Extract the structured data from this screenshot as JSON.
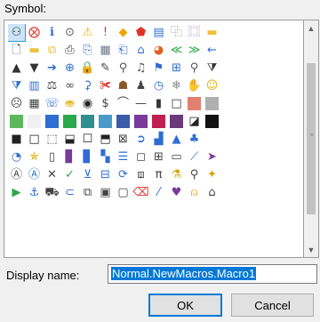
{
  "labels": {
    "symbol": "Symbol:",
    "display_name": "Display name:"
  },
  "display_name_value": "Normal.NewMacros.Macro1",
  "buttons": {
    "ok": "OK",
    "cancel": "Cancel"
  },
  "scroll": {
    "up_glyph": "▲",
    "down_glyph": "▼",
    "grip_glyph": "≡"
  },
  "selected_index": 0,
  "symbols": [
    {
      "t": "glyph",
      "g": "⚇",
      "c": "#3a3a3a",
      "n": "org-chart-icon"
    },
    {
      "t": "glyph",
      "g": "⨂",
      "c": "#e0342a",
      "n": "close-circle-icon"
    },
    {
      "t": "glyph",
      "g": "ℹ",
      "c": "#2f6dd1",
      "n": "info-icon"
    },
    {
      "t": "glyph",
      "g": "⊙",
      "c": "#555555",
      "n": "record-icon"
    },
    {
      "t": "glyph",
      "g": "⚠",
      "c": "#f2b300",
      "n": "warning-icon"
    },
    {
      "t": "glyph",
      "g": "!",
      "c": "#e0342a",
      "n": "exclamation-icon"
    },
    {
      "t": "glyph",
      "g": "◆",
      "c": "#f0a500",
      "n": "diamond-icon"
    },
    {
      "t": "glyph",
      "g": "⬟",
      "c": "#e0342a",
      "n": "shield-icon"
    },
    {
      "t": "glyph",
      "g": "▤",
      "c": "#2f6dd1",
      "n": "save-icon"
    },
    {
      "t": "glyph",
      "g": "⿻",
      "c": "#4a6b2a",
      "n": "network-icon"
    },
    {
      "t": "glyph",
      "g": "⿴",
      "c": "#7b3ab2",
      "n": "layout-icon"
    },
    {
      "t": "glyph",
      "g": "▬",
      "c": "#f0c040",
      "n": "folder-icon"
    },
    {
      "t": "glyph",
      "g": "",
      "c": "#000",
      "n": "empty-cell"
    },
    {
      "t": "glyph",
      "g": "",
      "c": "#000",
      "n": "empty-cell"
    },
    {
      "t": "glyph",
      "g": "",
      "c": "#000",
      "n": "empty-cell"
    },
    {
      "t": "glyph",
      "g": "",
      "c": "#000",
      "n": "empty-cell"
    },
    {
      "t": "glyph",
      "g": "🗋",
      "c": "#444",
      "n": "page-icon"
    },
    {
      "t": "glyph",
      "g": "▬",
      "c": "#f0c040",
      "n": "folder-open-icon"
    },
    {
      "t": "glyph",
      "g": "⧉",
      "c": "#f0c040",
      "n": "copy-folder-icon"
    },
    {
      "t": "glyph",
      "g": "⎙",
      "c": "#444",
      "n": "printer-icon"
    },
    {
      "t": "glyph",
      "g": "⎘",
      "c": "#2f6dd1",
      "n": "print-preview-icon"
    },
    {
      "t": "glyph",
      "g": "▦",
      "c": "#6c7a89",
      "n": "spreadsheet-icon"
    },
    {
      "t": "glyph",
      "g": "⎗",
      "c": "#2f6dd1",
      "n": "document-icon"
    },
    {
      "t": "glyph",
      "g": "⌂",
      "c": "#2f6dd1",
      "n": "home-icon"
    },
    {
      "t": "glyph",
      "g": "◕",
      "c": "#e06020",
      "n": "pie-chart-icon"
    },
    {
      "t": "glyph",
      "g": "≪",
      "c": "#2aa84a",
      "n": "double-back-icon"
    },
    {
      "t": "glyph",
      "g": "≫",
      "c": "#2aa84a",
      "n": "double-forward-icon"
    },
    {
      "t": "glyph",
      "g": "←",
      "c": "#2f6dd1",
      "n": "arrow-left-icon"
    },
    {
      "t": "glyph",
      "g": "",
      "c": "#000",
      "n": "empty-cell"
    },
    {
      "t": "glyph",
      "g": "",
      "c": "#000",
      "n": "empty-cell"
    },
    {
      "t": "glyph",
      "g": "",
      "c": "#000",
      "n": "empty-cell"
    },
    {
      "t": "glyph",
      "g": "",
      "c": "#000",
      "n": "empty-cell"
    },
    {
      "t": "glyph",
      "g": "▲",
      "c": "#333",
      "n": "triangle-up-icon"
    },
    {
      "t": "glyph",
      "g": "▼",
      "c": "#333",
      "n": "triangle-down-icon"
    },
    {
      "t": "glyph",
      "g": "➔",
      "c": "#2f6dd1",
      "n": "arrow-right-icon"
    },
    {
      "t": "glyph",
      "g": "⊕",
      "c": "#2f6dd1",
      "n": "circle-arrow-icon"
    },
    {
      "t": "glyph",
      "g": "🔒",
      "c": "#d4a800",
      "n": "lock-icon"
    },
    {
      "t": "glyph",
      "g": "✎",
      "c": "#444",
      "n": "pencil-icon"
    },
    {
      "t": "glyph",
      "g": "⚲",
      "c": "#555",
      "n": "pin-icon"
    },
    {
      "t": "glyph",
      "g": "♫",
      "c": "#555",
      "n": "music-icon"
    },
    {
      "t": "glyph",
      "g": "⚑",
      "c": "#2f6dd1",
      "n": "flag-icon"
    },
    {
      "t": "glyph",
      "g": "⊞",
      "c": "#2f6dd1",
      "n": "window-icon"
    },
    {
      "t": "glyph",
      "g": "⚲",
      "c": "#555",
      "n": "magnifier-icon"
    },
    {
      "t": "glyph",
      "g": "⧩",
      "c": "#333",
      "n": "filter-icon"
    },
    {
      "t": "glyph",
      "g": "",
      "c": "#000",
      "n": "empty-cell"
    },
    {
      "t": "glyph",
      "g": "",
      "c": "#000",
      "n": "empty-cell"
    },
    {
      "t": "glyph",
      "g": "",
      "c": "#000",
      "n": "empty-cell"
    },
    {
      "t": "glyph",
      "g": "",
      "c": "#000",
      "n": "empty-cell"
    },
    {
      "t": "glyph",
      "g": "⧩",
      "c": "#2f6dd1",
      "n": "funnel-icon"
    },
    {
      "t": "glyph",
      "g": "▥",
      "c": "#2f6dd1",
      "n": "table-icon"
    },
    {
      "t": "glyph",
      "g": "⚖",
      "c": "#444",
      "n": "scales-icon"
    },
    {
      "t": "glyph",
      "g": "∞",
      "c": "#444",
      "n": "infinity-icon"
    },
    {
      "t": "glyph",
      "g": "⚳",
      "c": "#2f6dd1",
      "n": "bulb-icon"
    },
    {
      "t": "glyph",
      "g": "✀",
      "c": "#e0342a",
      "n": "tools-icon"
    },
    {
      "t": "glyph",
      "g": "☗",
      "c": "#8a5a2a",
      "n": "user-icon"
    },
    {
      "t": "glyph",
      "g": "♟",
      "c": "#444",
      "n": "person-icon"
    },
    {
      "t": "glyph",
      "g": "◷",
      "c": "#2f6dd1",
      "n": "clock-icon"
    },
    {
      "t": "glyph",
      "g": "❄",
      "c": "#888",
      "n": "snowflake-icon"
    },
    {
      "t": "glyph",
      "g": "✋",
      "c": "#444",
      "n": "hand-icon"
    },
    {
      "t": "glyph",
      "g": "☺",
      "c": "#e0b000",
      "n": "smiley-icon"
    },
    {
      "t": "glyph",
      "g": "",
      "c": "#000",
      "n": "empty-cell"
    },
    {
      "t": "glyph",
      "g": "",
      "c": "#000",
      "n": "empty-cell"
    },
    {
      "t": "glyph",
      "g": "",
      "c": "#000",
      "n": "empty-cell"
    },
    {
      "t": "glyph",
      "g": "",
      "c": "#000",
      "n": "empty-cell"
    },
    {
      "t": "glyph",
      "g": "☹",
      "c": "#444",
      "n": "sad-face-icon"
    },
    {
      "t": "glyph",
      "g": "▦",
      "c": "#444",
      "n": "calculator-icon"
    },
    {
      "t": "glyph",
      "g": "☏",
      "c": "#2f6dd1",
      "n": "phone-icon"
    },
    {
      "t": "glyph",
      "g": "⛂",
      "c": "#e0b000",
      "n": "piggy-bank-icon"
    },
    {
      "t": "glyph",
      "g": "◉",
      "c": "#222",
      "n": "lens-icon"
    },
    {
      "t": "glyph",
      "g": "$",
      "c": "#444",
      "n": "dollar-icon"
    },
    {
      "t": "glyph",
      "g": "⌒",
      "c": "#444",
      "n": "wifi-icon"
    },
    {
      "t": "glyph",
      "g": "—",
      "c": "#444",
      "n": "dash-icon"
    },
    {
      "t": "glyph",
      "g": "▮",
      "c": "#333",
      "n": "grid-icon"
    },
    {
      "t": "glyph",
      "g": "□",
      "c": "#333",
      "n": "square-outline-icon"
    },
    {
      "t": "sw",
      "c": "#e08070",
      "n": "salmon-swatch"
    },
    {
      "t": "sw",
      "c": "#b0b0b0",
      "n": "gray-swatch"
    },
    {
      "t": "glyph",
      "g": "",
      "c": "#000",
      "n": "empty-cell"
    },
    {
      "t": "glyph",
      "g": "",
      "c": "#000",
      "n": "empty-cell"
    },
    {
      "t": "glyph",
      "g": "",
      "c": "#000",
      "n": "empty-cell"
    },
    {
      "t": "glyph",
      "g": "",
      "c": "#000",
      "n": "empty-cell"
    },
    {
      "t": "sw",
      "c": "#5cb85c",
      "n": "green-swatch"
    },
    {
      "t": "sw",
      "c": "#f0f0f0",
      "n": "white-swatch"
    },
    {
      "t": "sw",
      "c": "#2f6dd1",
      "n": "blue-swatch"
    },
    {
      "t": "sw",
      "c": "#2aa84a",
      "n": "green-dark-swatch"
    },
    {
      "t": "sw",
      "c": "#2f8f8f",
      "n": "teal-swatch"
    },
    {
      "t": "sw",
      "c": "#4a9ac9",
      "n": "lightblue-swatch"
    },
    {
      "t": "sw",
      "c": "#3b5ba8",
      "n": "navy-swatch"
    },
    {
      "t": "sw",
      "c": "#7a3a9a",
      "n": "purple-swatch"
    },
    {
      "t": "sw",
      "c": "#c02050",
      "n": "crimson-swatch"
    },
    {
      "t": "sw",
      "c": "#6a3a7a",
      "n": "plum-swatch"
    },
    {
      "t": "glyph",
      "g": "◪",
      "c": "#222",
      "n": "half-square-icon"
    },
    {
      "t": "sw",
      "c": "#111111",
      "n": "black-swatch"
    },
    {
      "t": "glyph",
      "g": "",
      "c": "#000",
      "n": "empty-cell"
    },
    {
      "t": "glyph",
      "g": "",
      "c": "#000",
      "n": "empty-cell"
    },
    {
      "t": "glyph",
      "g": "",
      "c": "#000",
      "n": "empty-cell"
    },
    {
      "t": "glyph",
      "g": "",
      "c": "#000",
      "n": "empty-cell"
    },
    {
      "t": "glyph",
      "g": "■",
      "c": "#222",
      "n": "black-square-icon"
    },
    {
      "t": "glyph",
      "g": "□",
      "c": "#222",
      "n": "frame-icon"
    },
    {
      "t": "glyph",
      "g": "⬚",
      "c": "#444",
      "n": "dashed-square-icon"
    },
    {
      "t": "glyph",
      "g": "⬓",
      "c": "#222",
      "n": "half-filled-square-icon"
    },
    {
      "t": "glyph",
      "g": "☐",
      "c": "#222",
      "n": "checkbox-outline-icon"
    },
    {
      "t": "glyph",
      "g": "⬒",
      "c": "#222",
      "n": "half-square-top-icon"
    },
    {
      "t": "glyph",
      "g": "⊠",
      "c": "#444",
      "n": "boxed-x-icon"
    },
    {
      "t": "glyph",
      "g": "➲",
      "c": "#2f6dd1",
      "n": "circle-right-icon"
    },
    {
      "t": "glyph",
      "g": "▟",
      "c": "#2f6dd1",
      "n": "bar-chart-icon"
    },
    {
      "t": "glyph",
      "g": "▲",
      "c": "#2f6dd1",
      "n": "mountain-icon"
    },
    {
      "t": "glyph",
      "g": "♣",
      "c": "#2f6dd1",
      "n": "people-icon"
    },
    {
      "t": "glyph",
      "g": "",
      "c": "#000",
      "n": "empty-cell"
    },
    {
      "t": "glyph",
      "g": "",
      "c": "#000",
      "n": "empty-cell"
    },
    {
      "t": "glyph",
      "g": "",
      "c": "#000",
      "n": "empty-cell"
    },
    {
      "t": "glyph",
      "g": "",
      "c": "#000",
      "n": "empty-cell"
    },
    {
      "t": "glyph",
      "g": "",
      "c": "#000",
      "n": "empty-cell"
    },
    {
      "t": "glyph",
      "g": "◔",
      "c": "#2f6dd1",
      "n": "pie-icon"
    },
    {
      "t": "glyph",
      "g": "✯",
      "c": "#d4a800",
      "n": "star-icon"
    },
    {
      "t": "glyph",
      "g": "▯",
      "c": "#444",
      "n": "page-blank-icon"
    },
    {
      "t": "glyph",
      "g": "▊",
      "c": "#7a3a9a",
      "n": "purple-book-icon"
    },
    {
      "t": "glyph",
      "g": "▊",
      "c": "#2f6dd1",
      "n": "blue-book-icon"
    },
    {
      "t": "glyph",
      "g": "▚",
      "c": "#2f6dd1",
      "n": "chart-area-icon"
    },
    {
      "t": "glyph",
      "g": "☰",
      "c": "#2f6dd1",
      "n": "list-icon"
    },
    {
      "t": "glyph",
      "g": "◻",
      "c": "#444",
      "n": "blank-square-icon"
    },
    {
      "t": "glyph",
      "g": "⊞",
      "c": "#444",
      "n": "grid-box-icon"
    },
    {
      "t": "glyph",
      "g": "▭",
      "c": "#444",
      "n": "textbox-icon"
    },
    {
      "t": "glyph",
      "g": "⟋",
      "c": "#2f6dd1",
      "n": "diagonal-icon"
    },
    {
      "t": "glyph",
      "g": "➤",
      "c": "#7a3a9a",
      "n": "arrow-purple-icon"
    },
    {
      "t": "glyph",
      "g": "",
      "c": "#000",
      "n": "empty-cell"
    },
    {
      "t": "glyph",
      "g": "",
      "c": "#000",
      "n": "empty-cell"
    },
    {
      "t": "glyph",
      "g": "",
      "c": "#000",
      "n": "empty-cell"
    },
    {
      "t": "glyph",
      "g": "",
      "c": "#000",
      "n": "empty-cell"
    },
    {
      "t": "glyph",
      "g": "Ⓐ",
      "c": "#444",
      "n": "letter-a-icon"
    },
    {
      "t": "glyph",
      "g": "Ⓐ",
      "c": "#2f6dd1",
      "n": "letter-a-blue-icon"
    },
    {
      "t": "glyph",
      "g": "✕",
      "c": "#444",
      "n": "x-icon"
    },
    {
      "t": "glyph",
      "g": "✓",
      "c": "#2aa84a",
      "n": "check-icon"
    },
    {
      "t": "glyph",
      "g": "⊻",
      "c": "#2f6dd1",
      "n": "merge-icon"
    },
    {
      "t": "glyph",
      "g": "⊟",
      "c": "#2f6dd1",
      "n": "minus-box-icon"
    },
    {
      "t": "glyph",
      "g": "⟳",
      "c": "#2f6dd1",
      "n": "refresh-icon"
    },
    {
      "t": "glyph",
      "g": "⧈",
      "c": "#444",
      "n": "brackets-icon"
    },
    {
      "t": "glyph",
      "g": "π",
      "c": "#444",
      "n": "pi-icon"
    },
    {
      "t": "glyph",
      "g": "⚗",
      "c": "#d4a800",
      "n": "flask-icon"
    },
    {
      "t": "glyph",
      "g": "⚲",
      "c": "#444",
      "n": "binoculars-icon"
    },
    {
      "t": "glyph",
      "g": "✦",
      "c": "#d4a800",
      "n": "magic-wand-icon"
    },
    {
      "t": "glyph",
      "g": "☰",
      "c": "#444",
      "n": "bullet-list-icon"
    },
    {
      "t": "glyph",
      "g": "",
      "c": "#000",
      "n": "empty-cell"
    },
    {
      "t": "glyph",
      "g": "",
      "c": "#000",
      "n": "empty-cell"
    },
    {
      "t": "glyph",
      "g": "",
      "c": "#000",
      "n": "empty-cell"
    },
    {
      "t": "glyph",
      "g": "▶",
      "c": "#2aa84a",
      "n": "play-icon"
    },
    {
      "t": "glyph",
      "g": "⚓",
      "c": "#2f6dd1",
      "n": "anchor-icon"
    },
    {
      "t": "glyph",
      "g": "⛟",
      "c": "#444",
      "n": "truck-icon"
    },
    {
      "t": "glyph",
      "g": "⊂",
      "c": "#2f6dd1",
      "n": "lasso-icon"
    },
    {
      "t": "glyph",
      "g": "⧉",
      "c": "#444",
      "n": "copy-icon"
    },
    {
      "t": "glyph",
      "g": "▣",
      "c": "#444",
      "n": "boxed-square-icon"
    },
    {
      "t": "glyph",
      "g": "▢",
      "c": "#444",
      "n": "rounded-square-icon"
    },
    {
      "t": "glyph",
      "g": "⌫",
      "c": "#e0342a",
      "n": "eraser-icon"
    },
    {
      "t": "glyph",
      "g": "⁄",
      "c": "#2f6dd1",
      "n": "slash-icon"
    },
    {
      "t": "glyph",
      "g": "♥",
      "c": "#7a3a9a",
      "n": "heart-icon"
    },
    {
      "t": "glyph",
      "g": "⍝",
      "c": "#d4a800",
      "n": "bell-icon"
    },
    {
      "t": "glyph",
      "g": "⌂",
      "c": "#444",
      "n": "tray-icon"
    },
    {
      "t": "glyph",
      "g": "",
      "c": "#000",
      "n": "empty-cell"
    },
    {
      "t": "glyph",
      "g": "",
      "c": "#000",
      "n": "empty-cell"
    },
    {
      "t": "glyph",
      "g": "",
      "c": "#000",
      "n": "empty-cell"
    },
    {
      "t": "glyph",
      "g": "",
      "c": "#000",
      "n": "empty-cell"
    }
  ]
}
